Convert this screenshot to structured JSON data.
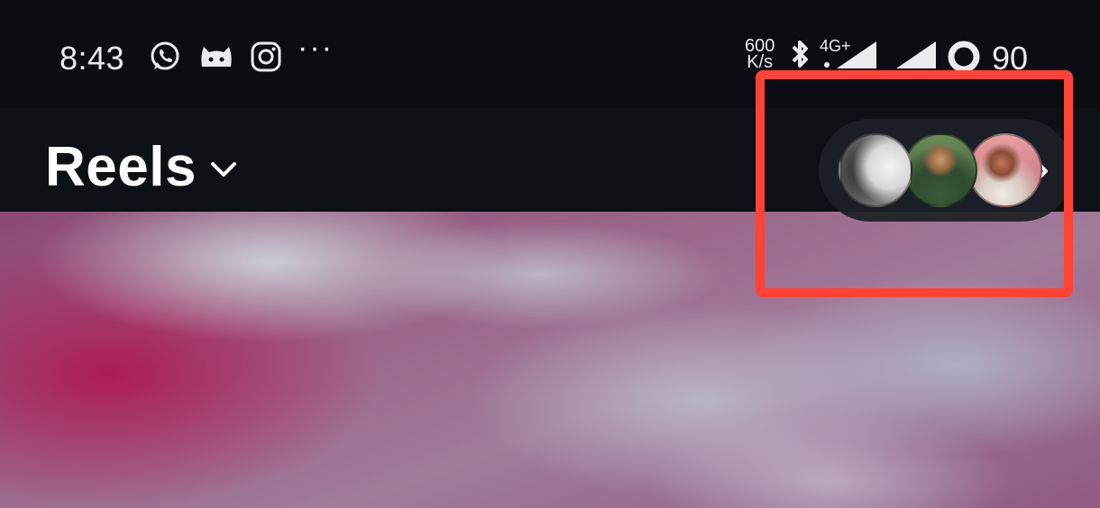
{
  "status_bar": {
    "time": "8:43",
    "app_icons": [
      "whatsapp-icon",
      "cat-app-icon",
      "instagram-icon"
    ],
    "more": "···",
    "net_speed_value": "600",
    "net_speed_unit": "K/s",
    "network_type": "4G+",
    "battery_level": "90"
  },
  "header": {
    "title": "Reels"
  },
  "following_strip": {
    "avatar_count": 3
  },
  "colors": {
    "highlight": "#ff4337",
    "background": "#0d1014",
    "text": "#ffffff"
  }
}
